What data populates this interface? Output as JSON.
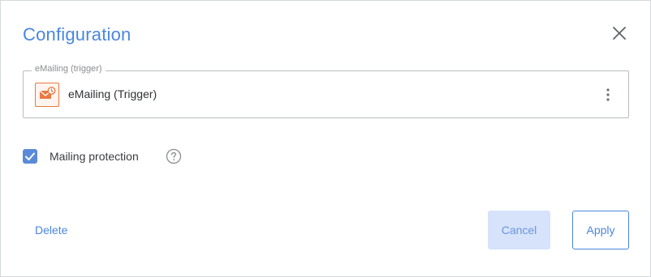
{
  "dialog": {
    "title": "Configuration"
  },
  "trigger": {
    "legend": "eMailing (trigger)",
    "label": "eMailing (Trigger)",
    "icon": "emailing-trigger-icon"
  },
  "protection": {
    "label": "Mailing protection",
    "checked": true
  },
  "actions": {
    "delete": "Delete",
    "cancel": "Cancel",
    "apply": "Apply"
  },
  "colors": {
    "accent": "#4a86e0",
    "checkbox": "#5b8bd8",
    "cancel_bg": "#d6e3fb",
    "trigger_icon": "#e97a42"
  }
}
